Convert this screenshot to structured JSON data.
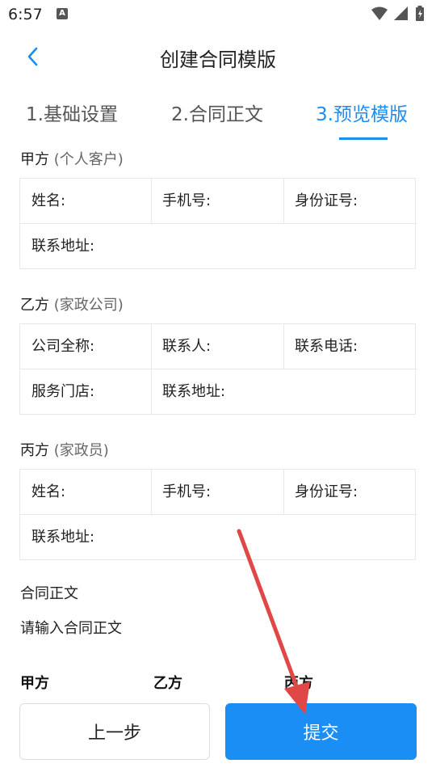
{
  "status_bar": {
    "time": "6:57",
    "notification_letter": "A"
  },
  "header": {
    "title": "创建合同模版"
  },
  "tabs": [
    {
      "label": "1.基础设置"
    },
    {
      "label": "2.合同正文"
    },
    {
      "label": "3.预览模版",
      "active": true
    }
  ],
  "party_a": {
    "title": "甲方",
    "subtitle": "(个人客户)",
    "fields": [
      "姓名:",
      "手机号:",
      "身份证号:",
      "联系地址:"
    ]
  },
  "party_b": {
    "title": "乙方",
    "subtitle": "(家政公司)",
    "fields": [
      "公司全称:",
      "联系人:",
      "联系电话:",
      "服务门店:",
      "联系地址:"
    ]
  },
  "party_c": {
    "title": "丙方",
    "subtitle": "(家政员)",
    "fields": [
      "姓名:",
      "手机号:",
      "身份证号:",
      "联系地址:"
    ]
  },
  "contract": {
    "label": "合同正文",
    "placeholder": "请输入合同正文"
  },
  "signatures": [
    "甲方",
    "乙方",
    "丙方"
  ],
  "buttons": {
    "prev": "上一步",
    "submit": "提交"
  },
  "colors": {
    "accent": "#1a8ef5",
    "annotation_arrow": "#e04848"
  }
}
